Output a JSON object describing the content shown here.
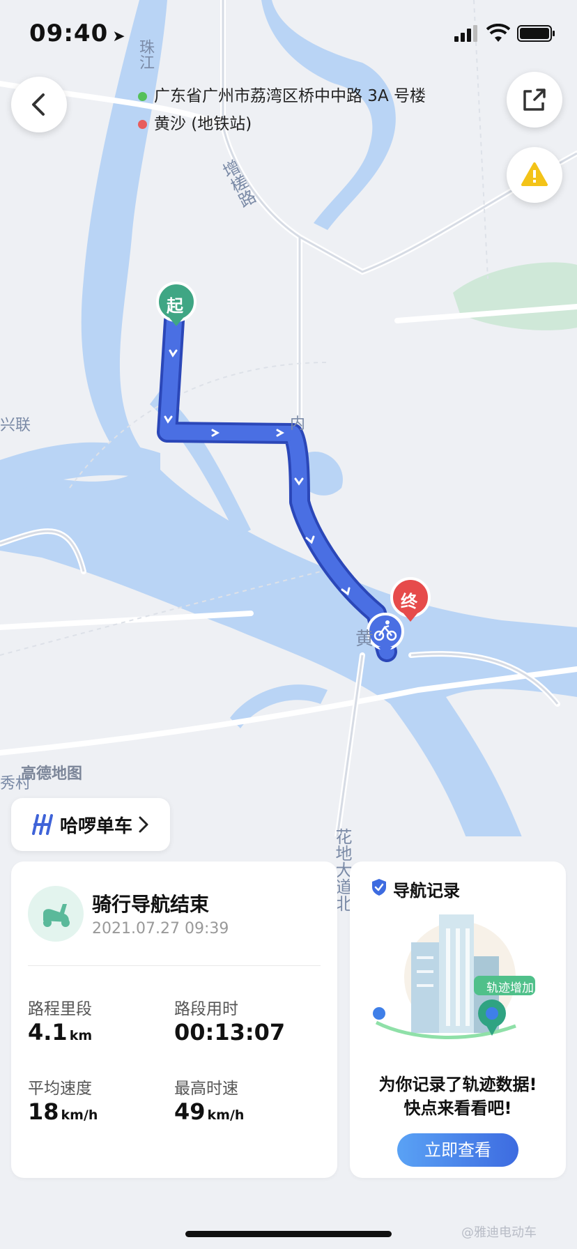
{
  "status_bar": {
    "time": "09:40"
  },
  "route": {
    "origin": "广东省广州市荔湾区桥中中路 3A 号楼",
    "destination": "黄沙 (地铁站)"
  },
  "map": {
    "labels": {
      "river": "珠江",
      "road1": "增槎路",
      "road2": "花地大道北",
      "area1": "兴联",
      "area2": "秀村",
      "inner": "内",
      "huang": "黄"
    },
    "start_marker": "起",
    "end_marker": "终",
    "watermark": "高德地图"
  },
  "brand_button": {
    "label": "哈啰单车"
  },
  "ride_card": {
    "title": "骑行导航结束",
    "datetime": "2021.07.27 09:39",
    "stats": [
      {
        "label": "路程里段",
        "value": "4.1",
        "unit": "km"
      },
      {
        "label": "路段用时",
        "value": "00:13:07",
        "unit": ""
      },
      {
        "label": "平均速度",
        "value": "18",
        "unit": "km/h"
      },
      {
        "label": "最高时速",
        "value": "49",
        "unit": "km/h"
      }
    ]
  },
  "record_card": {
    "title": "导航记录",
    "tag": "轨迹增加",
    "message_line1": "为你记录了轨迹数据!",
    "message_line2": "快点来看看吧!",
    "button_label": "立即查看"
  },
  "watermark": "@雅迪电动车",
  "colors": {
    "route_blue": "#4a6fe3",
    "river": "#b9d4f5",
    "start_green": "#3fa684",
    "end_red": "#e64b4b",
    "button_blue": "#3d7ff0"
  }
}
